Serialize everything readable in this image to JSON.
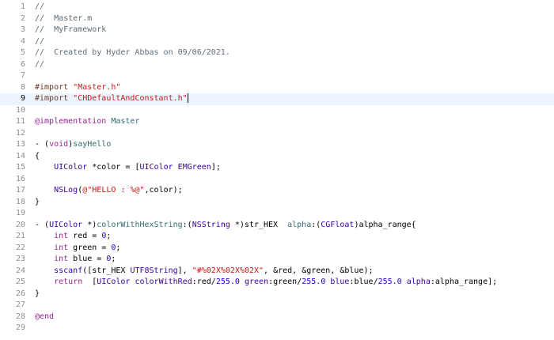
{
  "editor": {
    "lines": [
      {
        "n": "1",
        "tokens": [
          {
            "t": "//",
            "c": "c"
          }
        ]
      },
      {
        "n": "2",
        "tokens": [
          {
            "t": "//  Master.m",
            "c": "c"
          }
        ]
      },
      {
        "n": "3",
        "tokens": [
          {
            "t": "//  MyFramework",
            "c": "c"
          }
        ]
      },
      {
        "n": "4",
        "tokens": [
          {
            "t": "//",
            "c": "c"
          }
        ]
      },
      {
        "n": "5",
        "tokens": [
          {
            "t": "//  Created by Hyder Abbas on 09/06/2021.",
            "c": "c"
          }
        ]
      },
      {
        "n": "6",
        "tokens": [
          {
            "t": "//",
            "c": "c"
          }
        ]
      },
      {
        "n": "7",
        "tokens": []
      },
      {
        "n": "8",
        "tokens": [
          {
            "t": "#import ",
            "c": "pp"
          },
          {
            "t": "\"Master.h\"",
            "c": "s"
          }
        ]
      },
      {
        "n": "9",
        "current": true,
        "tokens": [
          {
            "t": "#import ",
            "c": "pp"
          },
          {
            "t": "\"CHDefaultAndConstant.h\"",
            "c": "s"
          }
        ]
      },
      {
        "n": "10",
        "tokens": []
      },
      {
        "n": "11",
        "tokens": [
          {
            "t": "@implementation",
            "c": "kw"
          },
          {
            "t": " "
          },
          {
            "t": "Master",
            "c": "fn"
          }
        ]
      },
      {
        "n": "12",
        "tokens": []
      },
      {
        "n": "13",
        "tokens": [
          {
            "t": "- ("
          },
          {
            "t": "void",
            "c": "kw"
          },
          {
            "t": ")"
          },
          {
            "t": "sayHello",
            "c": "fn"
          }
        ]
      },
      {
        "n": "14",
        "tokens": [
          {
            "t": "{"
          }
        ]
      },
      {
        "n": "15",
        "tokens": [
          {
            "t": "    "
          },
          {
            "t": "UIColor",
            "c": "ty"
          },
          {
            "t": " *color = ["
          },
          {
            "t": "UIColor",
            "c": "ty"
          },
          {
            "t": " "
          },
          {
            "t": "EMGreen",
            "c": "ty"
          },
          {
            "t": "];"
          }
        ]
      },
      {
        "n": "16",
        "tokens": []
      },
      {
        "n": "17",
        "tokens": [
          {
            "t": "    "
          },
          {
            "t": "NSLog",
            "c": "ty"
          },
          {
            "t": "("
          },
          {
            "t": "@\"HELLO : %@\"",
            "c": "s"
          },
          {
            "t": ",color);"
          }
        ]
      },
      {
        "n": "18",
        "tokens": [
          {
            "t": "}"
          }
        ]
      },
      {
        "n": "19",
        "tokens": []
      },
      {
        "n": "20",
        "tokens": [
          {
            "t": "- ("
          },
          {
            "t": "UIColor",
            "c": "ty"
          },
          {
            "t": " *)"
          },
          {
            "t": "colorWithHexString",
            "c": "fn"
          },
          {
            "t": ":("
          },
          {
            "t": "NSString",
            "c": "ty"
          },
          {
            "t": " *)str_HEX  "
          },
          {
            "t": "alpha",
            "c": "fn"
          },
          {
            "t": ":("
          },
          {
            "t": "CGFloat",
            "c": "ty"
          },
          {
            "t": ")alpha_range{"
          }
        ]
      },
      {
        "n": "21",
        "tokens": [
          {
            "t": "    "
          },
          {
            "t": "int",
            "c": "kw"
          },
          {
            "t": " red = "
          },
          {
            "t": "0",
            "c": "num"
          },
          {
            "t": ";"
          }
        ]
      },
      {
        "n": "22",
        "tokens": [
          {
            "t": "    "
          },
          {
            "t": "int",
            "c": "kw"
          },
          {
            "t": " green = "
          },
          {
            "t": "0",
            "c": "num"
          },
          {
            "t": ";"
          }
        ]
      },
      {
        "n": "23",
        "tokens": [
          {
            "t": "    "
          },
          {
            "t": "int",
            "c": "kw"
          },
          {
            "t": " blue = "
          },
          {
            "t": "0",
            "c": "num"
          },
          {
            "t": ";"
          }
        ]
      },
      {
        "n": "24",
        "tokens": [
          {
            "t": "    "
          },
          {
            "t": "sscanf",
            "c": "ty"
          },
          {
            "t": "([str_HEX "
          },
          {
            "t": "UTF8String",
            "c": "ty"
          },
          {
            "t": "], "
          },
          {
            "t": "\"#%02X%02X%02X\"",
            "c": "s"
          },
          {
            "t": ", &red, &green, &blue);"
          }
        ]
      },
      {
        "n": "25",
        "tokens": [
          {
            "t": "    "
          },
          {
            "t": "return",
            "c": "kw"
          },
          {
            "t": "  ["
          },
          {
            "t": "UIColor",
            "c": "ty"
          },
          {
            "t": " "
          },
          {
            "t": "colorWithRed",
            "c": "ty"
          },
          {
            "t": ":red/"
          },
          {
            "t": "255.0",
            "c": "num"
          },
          {
            "t": " "
          },
          {
            "t": "green",
            "c": "ty"
          },
          {
            "t": ":green/"
          },
          {
            "t": "255.0",
            "c": "num"
          },
          {
            "t": " "
          },
          {
            "t": "blue",
            "c": "ty"
          },
          {
            "t": ":blue/"
          },
          {
            "t": "255.0",
            "c": "num"
          },
          {
            "t": " "
          },
          {
            "t": "alpha",
            "c": "ty"
          },
          {
            "t": ":alpha_range];"
          }
        ]
      },
      {
        "n": "26",
        "tokens": [
          {
            "t": "}"
          }
        ]
      },
      {
        "n": "27",
        "tokens": []
      },
      {
        "n": "28",
        "tokens": [
          {
            "t": "@end",
            "c": "kw"
          }
        ]
      },
      {
        "n": "29",
        "tokens": []
      }
    ],
    "caret_line": "9"
  },
  "colors": {
    "comment": "#5d6c79",
    "preprocessor": "#643820",
    "string": "#c41a16",
    "keyword": "#9b2393",
    "type": "#3900a0",
    "declaration": "#326d74",
    "number": "#1c00cf",
    "current_line": "#ecf5ff",
    "line_number": "#8e8e93"
  }
}
